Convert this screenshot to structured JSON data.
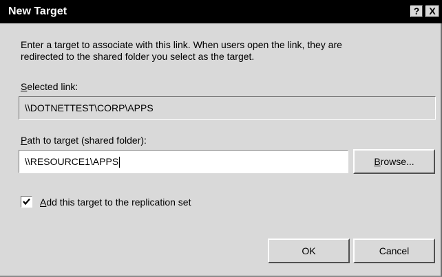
{
  "window": {
    "title": "New Target",
    "help_label": "?",
    "close_label": "X"
  },
  "description": {
    "line1": "Enter a target to associate with this link. When users open the link, they are",
    "line2": "redirected to the shared folder you select as the target."
  },
  "selected_link": {
    "label_mnemonic": "S",
    "label_rest": "elected link:",
    "value": "\\\\DOTNETTEST\\CORP\\APPS"
  },
  "path_to_target": {
    "label_mnemonic": "P",
    "label_rest": "ath to target (shared folder):",
    "value": "\\\\RESOURCE1\\APPS"
  },
  "browse_button": {
    "mnemonic": "B",
    "rest": "rowse..."
  },
  "replication_checkbox": {
    "checked": true,
    "label_mnemonic": "A",
    "label_rest": "dd this target to the replication set"
  },
  "ok_button": {
    "label": "OK"
  },
  "cancel_button": {
    "label": "Cancel"
  }
}
